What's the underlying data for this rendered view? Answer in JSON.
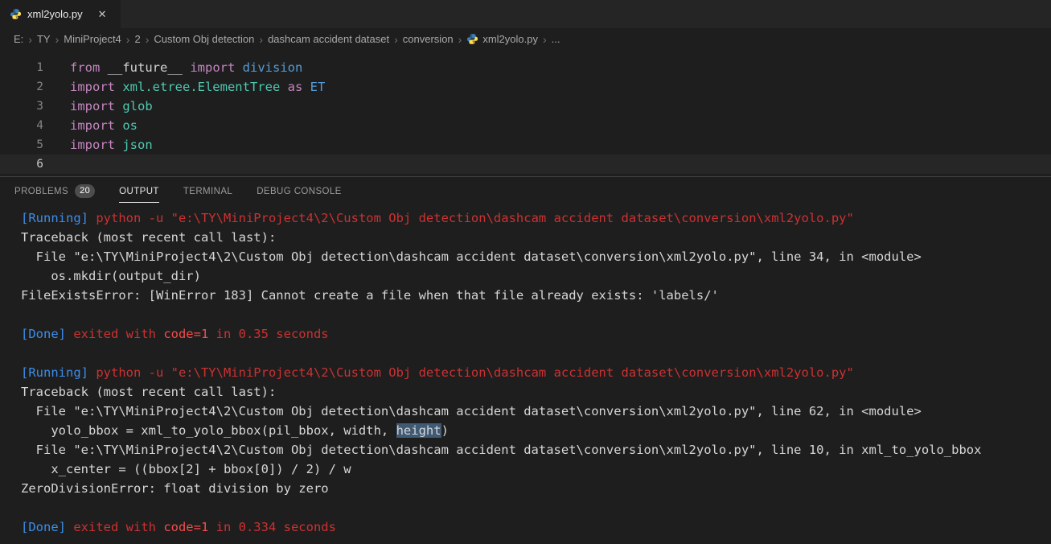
{
  "colors": {
    "kw": "#C586C0",
    "plain": "#D4D4D4",
    "mod": "#4EC9B0",
    "blue2": "#569CD6",
    "blue": "#3B8EEA",
    "red": "#CD3131",
    "red_bright": "#F14C4C",
    "white": "#D6D6D6",
    "selection": "#3E5A75"
  },
  "tab": {
    "title": "xml2yolo.py",
    "close_label": "✕"
  },
  "breadcrumb": {
    "separator": "›",
    "items": [
      {
        "label": "E:"
      },
      {
        "label": "TY"
      },
      {
        "label": "MiniProject4"
      },
      {
        "label": "2"
      },
      {
        "label": "Custom Obj detection"
      },
      {
        "label": "dashcam accident dataset"
      },
      {
        "label": "conversion"
      },
      {
        "label": "xml2yolo.py",
        "icon": "python-file-icon"
      },
      {
        "label": "..."
      }
    ]
  },
  "editor": {
    "lines": [
      {
        "number": "1",
        "active": false,
        "tokens": [
          [
            "from ",
            "kw"
          ],
          [
            "__future__ ",
            "plain"
          ],
          [
            "import ",
            "kw"
          ],
          [
            "division",
            "blue2"
          ]
        ]
      },
      {
        "number": "2",
        "active": false,
        "tokens": [
          [
            "import ",
            "kw"
          ],
          [
            "xml.etree.ElementTree ",
            "mod"
          ],
          [
            "as ",
            "kw"
          ],
          [
            "ET",
            "blue2"
          ]
        ]
      },
      {
        "number": "3",
        "active": false,
        "tokens": [
          [
            "import ",
            "kw"
          ],
          [
            "glob",
            "mod"
          ]
        ]
      },
      {
        "number": "4",
        "active": false,
        "tokens": [
          [
            "import ",
            "kw"
          ],
          [
            "os",
            "mod"
          ]
        ]
      },
      {
        "number": "5",
        "active": false,
        "tokens": [
          [
            "import ",
            "kw"
          ],
          [
            "json",
            "mod"
          ]
        ]
      },
      {
        "number": "6",
        "active": true,
        "tokens": []
      }
    ]
  },
  "panel": {
    "tabs": [
      {
        "label": "PROBLEMS",
        "badge": "20",
        "active": false
      },
      {
        "label": "OUTPUT",
        "active": true
      },
      {
        "label": "TERMINAL",
        "active": false
      },
      {
        "label": "DEBUG CONSOLE",
        "active": false
      }
    ]
  },
  "output": {
    "lines": [
      {
        "segments": [
          [
            "[Running] ",
            "blue"
          ],
          [
            "python -u \"e:\\TY\\MiniProject4\\2\\Custom Obj detection\\dashcam accident dataset\\conversion\\xml2yolo.py\"",
            "red"
          ]
        ]
      },
      {
        "segments": [
          [
            "Traceback (most recent call last):",
            "white"
          ]
        ]
      },
      {
        "segments": [
          [
            "  File \"e:\\TY\\MiniProject4\\2\\Custom Obj detection\\dashcam accident dataset\\conversion\\xml2yolo.py\", line 34, in <module>",
            "white"
          ]
        ]
      },
      {
        "segments": [
          [
            "    os.mkdir(output_dir)",
            "white"
          ]
        ]
      },
      {
        "segments": [
          [
            "FileExistsError: [WinError 183] Cannot create a file when that file already exists: 'labels/'",
            "white"
          ]
        ]
      },
      {
        "segments": []
      },
      {
        "segments": [
          [
            "[Done] ",
            "blue"
          ],
          [
            "exited with ",
            "red"
          ],
          [
            "code=1",
            "red_bright"
          ],
          [
            " in 0.35 seconds",
            "red"
          ]
        ]
      },
      {
        "segments": []
      },
      {
        "segments": [
          [
            "[Running] ",
            "blue"
          ],
          [
            "python -u \"e:\\TY\\MiniProject4\\2\\Custom Obj detection\\dashcam accident dataset\\conversion\\xml2yolo.py\"",
            "red"
          ]
        ]
      },
      {
        "segments": [
          [
            "Traceback (most recent call last):",
            "white"
          ]
        ]
      },
      {
        "segments": [
          [
            "  File \"e:\\TY\\MiniProject4\\2\\Custom Obj detection\\dashcam accident dataset\\conversion\\xml2yolo.py\", line 62, in <module>",
            "white"
          ]
        ]
      },
      {
        "segments": [
          [
            "    yolo_bbox = xml_to_yolo_bbox(pil_bbox, width, ",
            "white"
          ],
          [
            "height",
            "white_sel"
          ],
          [
            ")",
            "white"
          ]
        ]
      },
      {
        "segments": [
          [
            "  File \"e:\\TY\\MiniProject4\\2\\Custom Obj detection\\dashcam accident dataset\\conversion\\xml2yolo.py\", line 10, in xml_to_yolo_bbox",
            "white"
          ]
        ]
      },
      {
        "segments": [
          [
            "    x_center = ((bbox[2] + bbox[0]) / 2) / w",
            "white"
          ]
        ]
      },
      {
        "segments": [
          [
            "ZeroDivisionError: float division by zero",
            "white"
          ]
        ]
      },
      {
        "segments": []
      },
      {
        "segments": [
          [
            "[Done] ",
            "blue"
          ],
          [
            "exited with ",
            "red"
          ],
          [
            "code=1",
            "red_bright"
          ],
          [
            " in 0.334 seconds",
            "red"
          ]
        ]
      }
    ]
  }
}
